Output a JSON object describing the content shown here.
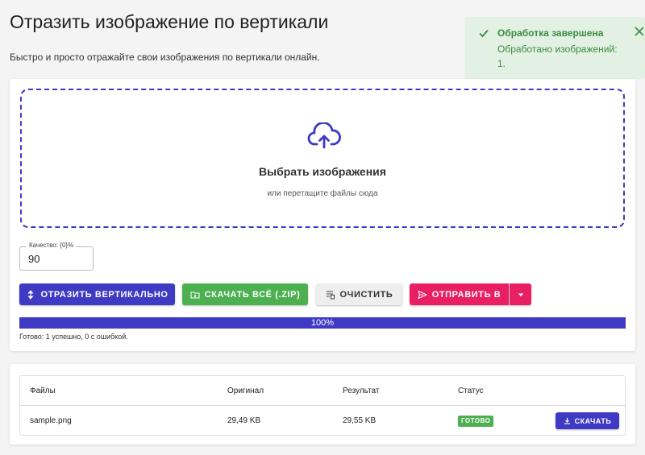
{
  "header": {
    "title": "Отразить изображение по вертикали",
    "subtitle": "Быстро и просто отражайте свои изображения по вертикали онлайн."
  },
  "toast": {
    "title": "Обработка завершена",
    "message": "Обработано изображений: 1.",
    "icon": "check-icon",
    "close_icon": "close-icon"
  },
  "dropzone": {
    "icon": "cloud-upload-icon",
    "title": "Выбрать изображения",
    "hint": "или перетащите файлы сюда"
  },
  "quality": {
    "label": "Качество: {0}%",
    "value": "90"
  },
  "buttons": {
    "flip": "ОТРАЗИТЬ ВЕРТИКАЛЬНО",
    "download_all": "СКАЧАТЬ ВСЁ (.ZIP)",
    "clear": "ОЧИСТИТЬ",
    "send": "ОТПРАВИТЬ В"
  },
  "progress": {
    "percent": 100,
    "label": "100%",
    "status": "Готово: 1 успешно, 0 с ошибкой."
  },
  "table": {
    "headers": [
      "Файлы",
      "Оригинал",
      "Результат",
      "Статус"
    ],
    "rows": [
      {
        "file": "sample.png",
        "original": "29,49 KB",
        "result": "29,55 KB",
        "status": "ГОТОВО",
        "action": "СКАЧАТЬ"
      }
    ]
  },
  "colors": {
    "primary": "#3f3ac4",
    "success": "#4caf50",
    "send": "#e91e63",
    "toast_bg": "#e3f1e4",
    "toast_text": "#3a8b3e"
  }
}
